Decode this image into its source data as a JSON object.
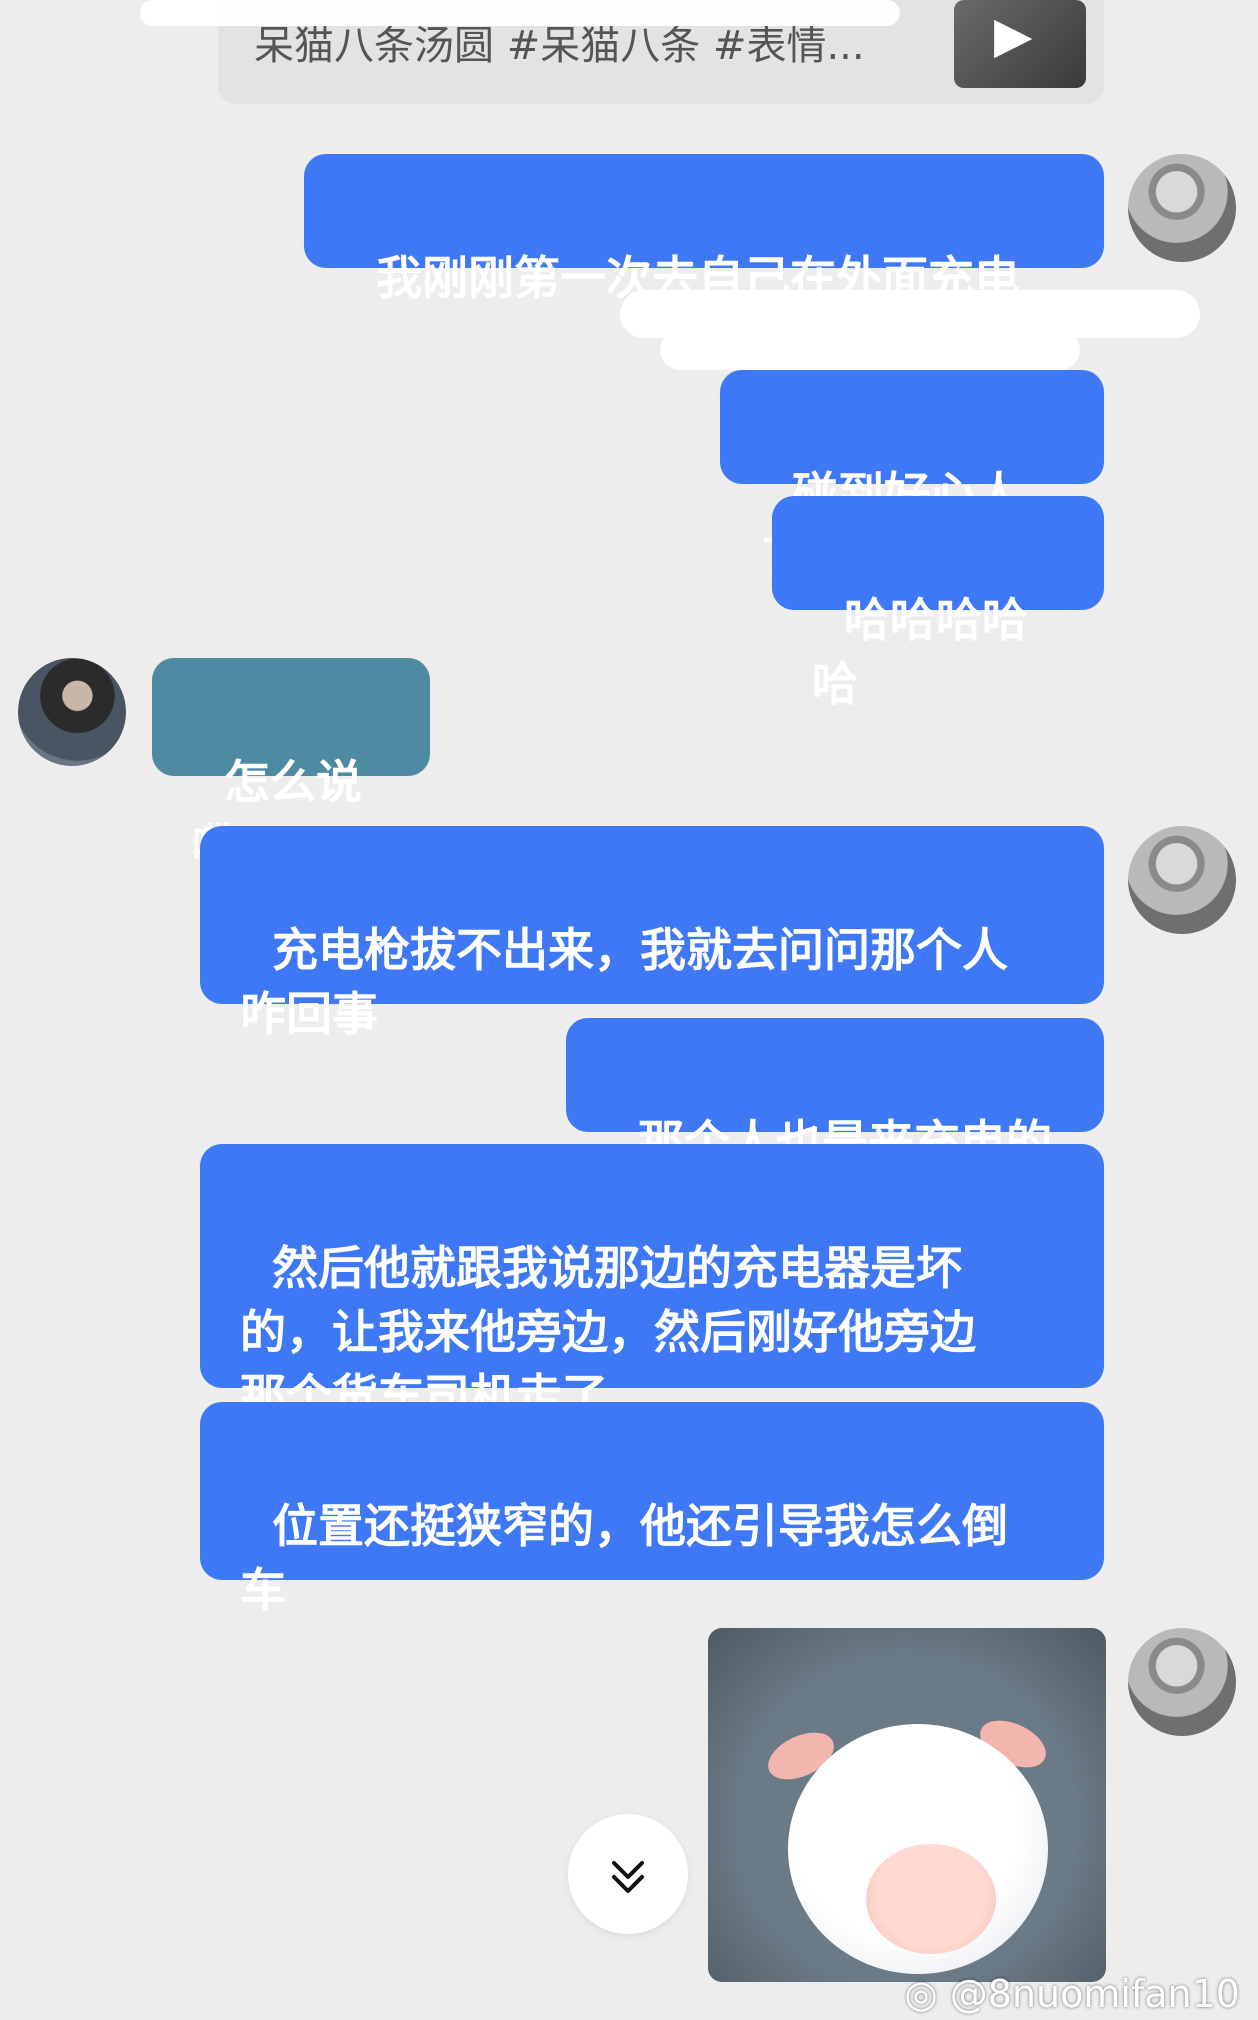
{
  "share_card": {
    "text": "呆猫八条汤圆 #呆猫八条 #表情..."
  },
  "messages": [
    {
      "side": "out",
      "text": "我刚刚第一次去自己在外面充电"
    },
    {
      "side": "out",
      "text": "碰到好心人了"
    },
    {
      "side": "out",
      "text": "哈哈哈哈哈"
    },
    {
      "side": "in",
      "text": "怎么说嘞"
    },
    {
      "side": "out",
      "text": "充电枪拔不出来，我就去问问那个人\n咋回事"
    },
    {
      "side": "out",
      "text": "那个人也是来充电的"
    },
    {
      "side": "out",
      "text": "然后他就跟我说那边的充电器是坏\n的，让我来他旁边，然后刚好他旁边\n那个货车司机走了"
    },
    {
      "side": "out",
      "text": "位置还挺狭窄的，他还引导我怎么倒\n车"
    }
  ],
  "scroll_button": {
    "icon": "chevron-double-down-icon",
    "glyph": "⌄"
  },
  "watermark": {
    "text": "@8nuomifan10"
  },
  "colors": {
    "outgoing": "#3f78f5",
    "incoming": "#4f8aa3",
    "background": "#ededed"
  }
}
